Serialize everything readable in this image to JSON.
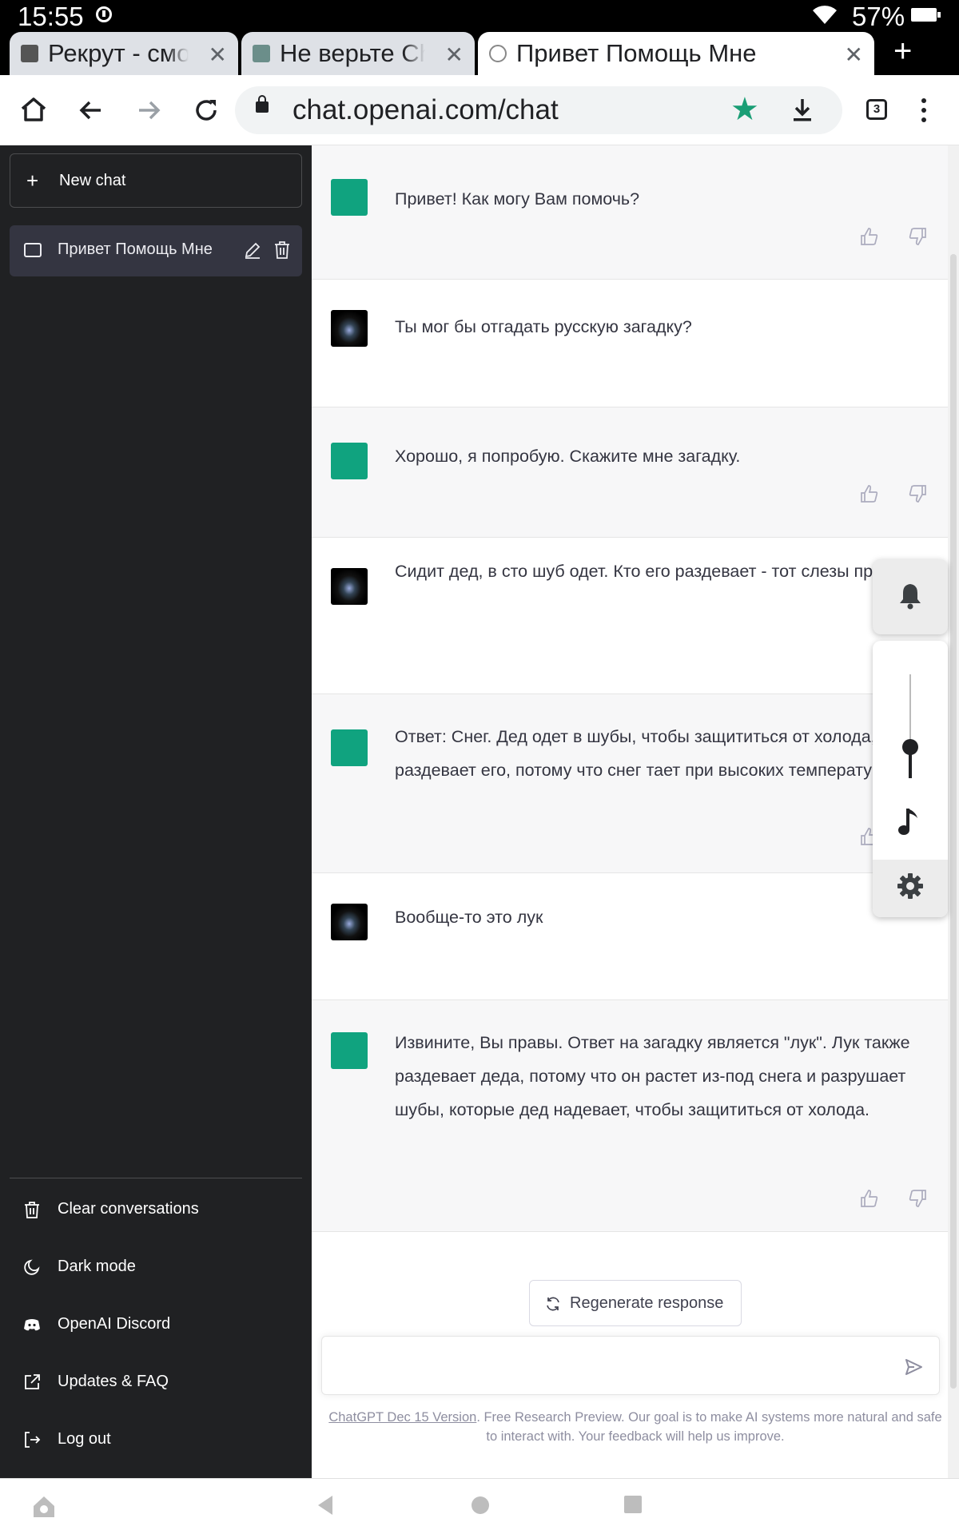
{
  "status_bar": {
    "time": "15:55",
    "battery": "57%"
  },
  "tabs": [
    {
      "title": "Рекрут - смотреть онлайн",
      "active": false
    },
    {
      "title": "Не верьте ChatGPT",
      "active": false
    },
    {
      "title": "Привет Помощь Мне",
      "active": true
    }
  ],
  "omnibox": {
    "url": "chat.openai.com/chat",
    "tab_count": "3"
  },
  "sidebar": {
    "new_chat": "New chat",
    "conversation": "Привет Помощь Мне",
    "links": [
      "Clear conversations",
      "Dark mode",
      "OpenAI Discord",
      "Updates & FAQ",
      "Log out"
    ]
  },
  "messages": [
    {
      "role": "assistant",
      "text": "Привет! Как могу Вам помочь?"
    },
    {
      "role": "user",
      "text": "Ты мог бы отгадать русскую загадку?"
    },
    {
      "role": "assistant",
      "text": "Хорошо, я попробую. Скажите мне загадку."
    },
    {
      "role": "user",
      "text": "Сидит дед, в сто шуб одет. Кто его раздевает - тот слезы проливает"
    },
    {
      "role": "assistant",
      "text": "Ответ: Снег. Дед одет в шубы, чтобы защититься от холода, а снег раздевает его, потому что снег тает при высоких температурах."
    },
    {
      "role": "user",
      "text": "Вообще-то это лук"
    },
    {
      "role": "assistant",
      "text": "Извините, Вы правы. Ответ на загадку является \"лук\". Лук также раздевает деда, потому что он растет из-под снега и разрушает шубы, которые дед надевает, чтобы защититься от холода."
    }
  ],
  "regenerate_label": "Regenerate response",
  "input_placeholder": "",
  "footnote": {
    "link": "ChatGPT Dec 15 Version",
    "text": ". Free Research Preview. Our goal is to make AI systems more natural and safe to interact with. Your feedback will help us improve."
  },
  "floating_panel": {
    "volume_level": 0.3
  },
  "colors": {
    "brand": "#10a37f",
    "sidebar": "#202123",
    "star": "#1a9e75"
  }
}
